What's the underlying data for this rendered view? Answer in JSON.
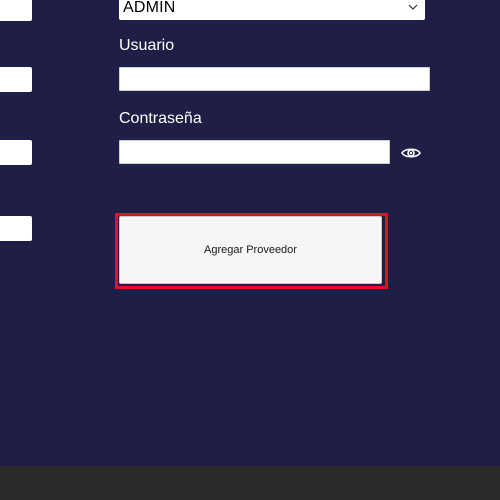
{
  "form": {
    "role_select": {
      "value": "ADMIN"
    },
    "user_label": "Usuario",
    "user_value": "",
    "password_label": "Contraseña",
    "password_value": "",
    "submit_label": "Agregar Proveedor"
  },
  "colors": {
    "background": "#1e1e47",
    "highlight": "#e0141f",
    "bottom_bar": "#2b2b2b"
  },
  "icons": {
    "select_toggle": "chevron-down-icon",
    "password_toggle": "eye-icon"
  }
}
